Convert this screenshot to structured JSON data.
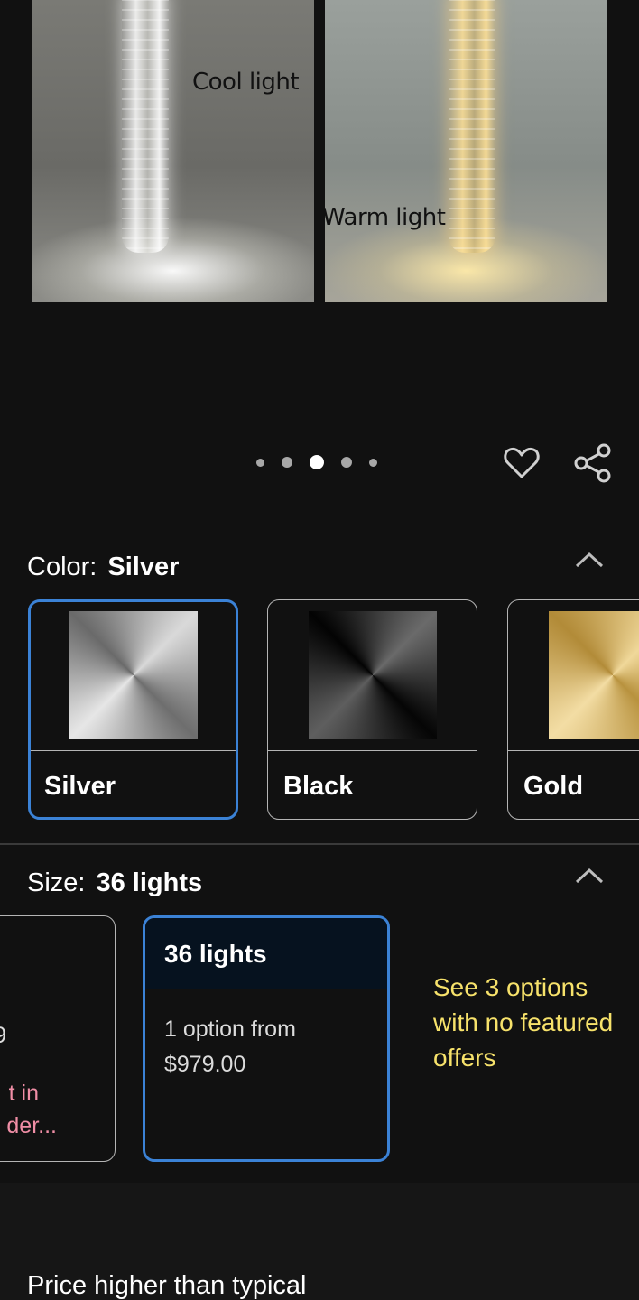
{
  "hero": {
    "left_caption": "Cool light",
    "right_caption": "Warm light"
  },
  "carousel": {
    "dot_count": 5,
    "active_index": 2
  },
  "actions": {
    "favorite_icon": "heart-icon",
    "share_icon": "share-icon"
  },
  "color": {
    "label": "Color:",
    "selected": "Silver",
    "options": [
      {
        "name": "Silver",
        "selected": true
      },
      {
        "name": "Black",
        "selected": false
      },
      {
        "name": "Gold",
        "selected": false
      }
    ]
  },
  "size": {
    "label": "Size:",
    "selected": "36 lights",
    "prev_card_fragments": [
      "9",
      "t in",
      "der..."
    ],
    "selected_card": {
      "title": "36 lights",
      "price_text": "1 option from $979.00"
    },
    "see_more": "See 3 options with no featured offers"
  },
  "price_note": "Price higher than typical",
  "colors": {
    "background": "#111111",
    "selected_border": "#3b82d6",
    "link_yellow": "#f7e26b",
    "warning_pink": "#f08ea6"
  }
}
